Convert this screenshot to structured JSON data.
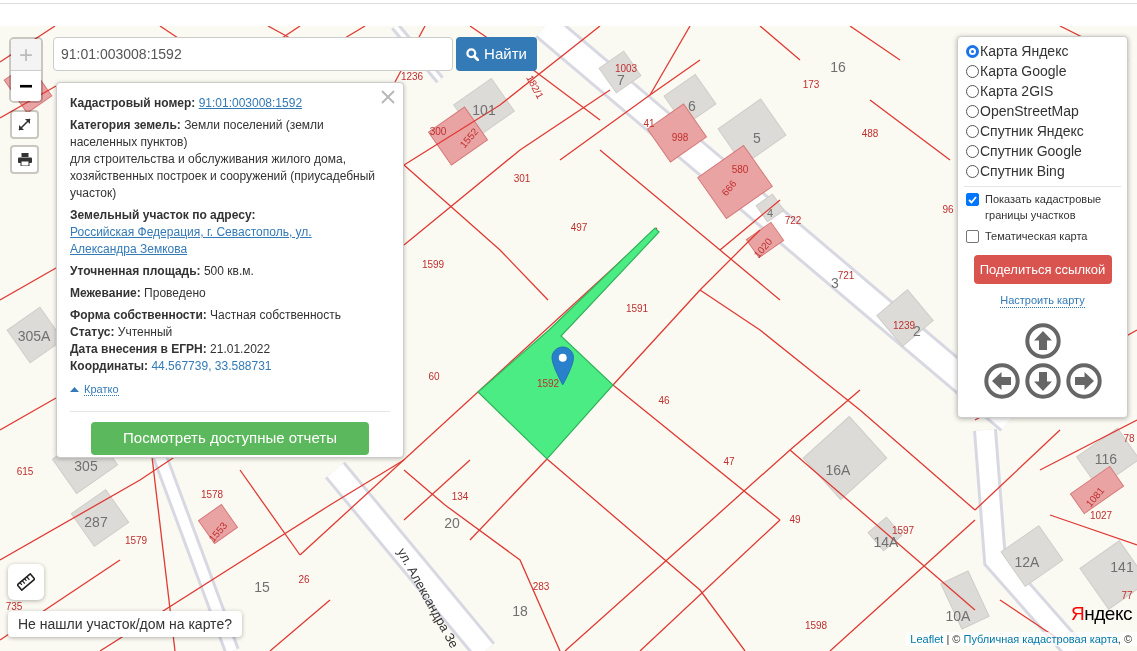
{
  "search": {
    "value": "91:01:003008:1592",
    "button": "Найти"
  },
  "zoom": [
    {
      "label": "+",
      "disabled": true
    },
    {
      "label": "−",
      "disabled": false
    }
  ],
  "popup": {
    "groups": [
      [
        {
          "label": "Кадастровый номер:",
          "value": "91:01:003008:1592",
          "kind": "link"
        }
      ],
      [
        {
          "label": "Категория земель:",
          "value": "Земли поселений (земли населенных пунктов)",
          "detail": "для строительства и обслуживания жилого дома, хозяйственных построек и сооружений (приусадебный участок)",
          "kind": "text"
        }
      ],
      [
        {
          "label": "Земельный участок по адресу:",
          "value": "Российская Федерация, г. Севастополь, ул. Александра Земкова",
          "kind": "link"
        }
      ],
      [
        {
          "label": "Уточненная площадь:",
          "value": "500 кв.м.",
          "kind": "text"
        }
      ],
      [
        {
          "label": "Межевание:",
          "value": "Проведено",
          "kind": "text"
        }
      ],
      [
        {
          "label": "Форма собственности:",
          "value": "Частная собственность",
          "kind": "text"
        },
        {
          "label": "Статус:",
          "value": "Учтенный",
          "kind": "text"
        },
        {
          "label": "Дата внесения в ЕГРН:",
          "value": "21.01.2022",
          "kind": "text"
        },
        {
          "label": "Координаты:",
          "value": "44.567739, 33.588731",
          "kind": "coords"
        }
      ]
    ],
    "toggle": "Кратко",
    "report_button": "Посмотреть доступные отчеты"
  },
  "layers": [
    {
      "label": "Карта Яндекс",
      "selected": true
    },
    {
      "label": "Карта Google",
      "selected": false
    },
    {
      "label": "Карта 2GIS",
      "selected": false
    },
    {
      "label": "OpenStreetMap",
      "selected": false
    },
    {
      "label": "Спутник Яндекс",
      "selected": false
    },
    {
      "label": "Спутник Google",
      "selected": false
    },
    {
      "label": "Спутник Bing",
      "selected": false
    }
  ],
  "options": [
    {
      "label": "Показать кадастровые границы участков",
      "checked": true
    },
    {
      "label": "Тематическая карта",
      "checked": false
    }
  ],
  "share_button": "Поделиться ссылкой",
  "settings_link": "Настроить карту",
  "help_tip": "Не нашли участок/дом на карте?",
  "map": {
    "labels": [
      {
        "text": "1236",
        "kind": "parcel"
      },
      {
        "text": "182/1",
        "kind": "parcel"
      },
      {
        "text": "1003",
        "kind": "parcel"
      },
      {
        "text": "173",
        "kind": "parcel"
      },
      {
        "text": "300",
        "kind": "parcel"
      },
      {
        "text": "1552",
        "kind": "parcel"
      },
      {
        "text": "41",
        "kind": "parcel"
      },
      {
        "text": "998",
        "kind": "parcel"
      },
      {
        "text": "488",
        "kind": "parcel"
      },
      {
        "text": "580",
        "kind": "parcel"
      },
      {
        "text": "666",
        "kind": "parcel"
      },
      {
        "text": "301",
        "kind": "parcel"
      },
      {
        "text": "96",
        "kind": "parcel"
      },
      {
        "text": "722",
        "kind": "parcel"
      },
      {
        "text": "497",
        "kind": "parcel"
      },
      {
        "text": "1020",
        "kind": "parcel"
      },
      {
        "text": "1599",
        "kind": "parcel"
      },
      {
        "text": "721",
        "kind": "parcel"
      },
      {
        "text": "1591",
        "kind": "parcel"
      },
      {
        "text": "1239",
        "kind": "parcel"
      },
      {
        "text": "60",
        "kind": "parcel"
      },
      {
        "text": "1592",
        "kind": "parcel"
      },
      {
        "text": "46",
        "kind": "parcel"
      },
      {
        "text": "78",
        "kind": "parcel"
      },
      {
        "text": "47",
        "kind": "parcel"
      },
      {
        "text": "615",
        "kind": "parcel"
      },
      {
        "text": "134",
        "kind": "parcel"
      },
      {
        "text": "1578",
        "kind": "parcel"
      },
      {
        "text": "1081",
        "kind": "parcel"
      },
      {
        "text": "1027",
        "kind": "parcel"
      },
      {
        "text": "49",
        "kind": "parcel"
      },
      {
        "text": "1597",
        "kind": "parcel"
      },
      {
        "text": "1553",
        "kind": "parcel"
      },
      {
        "text": "1579",
        "kind": "parcel"
      },
      {
        "text": "26",
        "kind": "parcel"
      },
      {
        "text": "283",
        "kind": "parcel"
      },
      {
        "text": "77",
        "kind": "parcel"
      },
      {
        "text": "735",
        "kind": "parcel"
      },
      {
        "text": "1598",
        "kind": "parcel"
      },
      {
        "text": "101",
        "kind": "house"
      },
      {
        "text": "7",
        "kind": "house"
      },
      {
        "text": "16",
        "kind": "house"
      },
      {
        "text": "6",
        "kind": "house"
      },
      {
        "text": "5",
        "kind": "house"
      },
      {
        "text": "4",
        "kind": "house"
      },
      {
        "text": "3",
        "kind": "house"
      },
      {
        "text": "2",
        "kind": "house"
      },
      {
        "text": "305A",
        "kind": "house"
      },
      {
        "text": "305",
        "kind": "house"
      },
      {
        "text": "16A",
        "kind": "house"
      },
      {
        "text": "116",
        "kind": "house"
      },
      {
        "text": "287",
        "kind": "house"
      },
      {
        "text": "20",
        "kind": "house"
      },
      {
        "text": "14A",
        "kind": "house"
      },
      {
        "text": "12A",
        "kind": "house"
      },
      {
        "text": "141",
        "kind": "house"
      },
      {
        "text": "15",
        "kind": "house"
      },
      {
        "text": "18",
        "kind": "house"
      },
      {
        "text": "10A",
        "kind": "house"
      },
      {
        "text": "ул. Александра Зе",
        "kind": "street"
      }
    ],
    "logo": "Яндекс"
  },
  "attribution": [
    {
      "text": "Leaflet",
      "kind": "link"
    },
    {
      "text": " | © ",
      "kind": "text"
    },
    {
      "text": "Публичная кадастровая карта",
      "kind": "link"
    },
    {
      "text": ", ©",
      "kind": "text"
    }
  ]
}
